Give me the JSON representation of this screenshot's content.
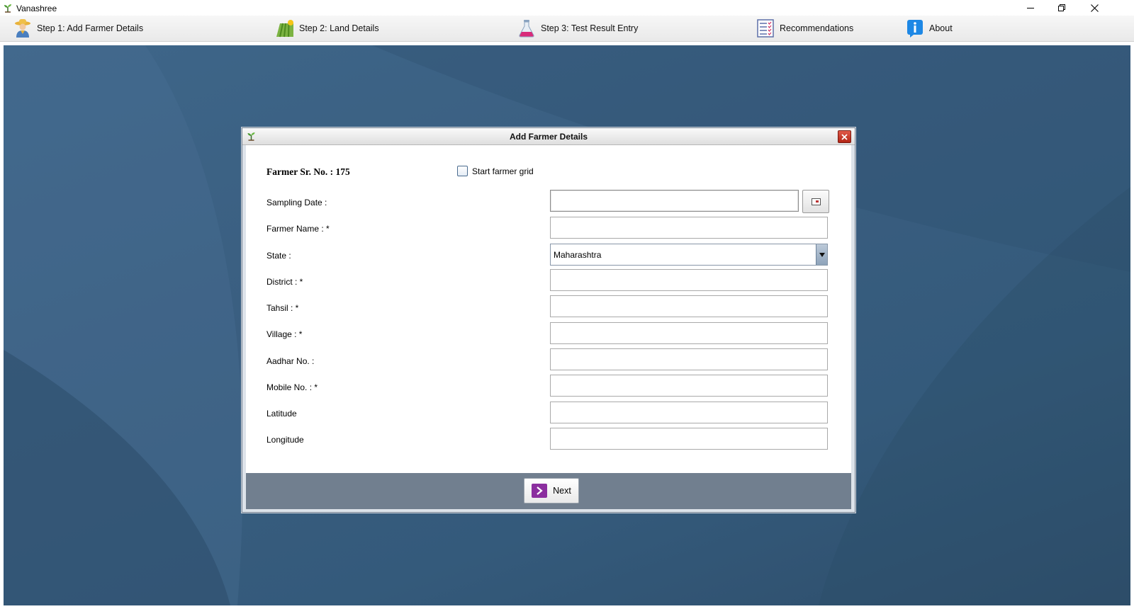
{
  "window": {
    "title": "Vanashree",
    "controls": [
      "minimize-icon",
      "restore-icon",
      "close-icon"
    ]
  },
  "toolbar": {
    "items": [
      {
        "label": "Step 1: Add Farmer Details",
        "icon": "farmer-icon"
      },
      {
        "label": "Step 2: Land Details",
        "icon": "field-icon"
      },
      {
        "label": "Step 3: Test Result Entry",
        "icon": "flask-icon"
      },
      {
        "label": "Recommendations",
        "icon": "checklist-icon"
      },
      {
        "label": "About",
        "icon": "info-icon"
      }
    ]
  },
  "dialog": {
    "title": "Add Farmer Details",
    "farmer_sr_label": "Farmer Sr. No.  : 175",
    "start_grid_label": "Start farmer grid",
    "fields": [
      {
        "label": "Sampling Date :",
        "value": ""
      },
      {
        "label": "Farmer Name : *",
        "value": ""
      },
      {
        "label": "State :",
        "value": "Maharashtra"
      },
      {
        "label": "District : *",
        "value": ""
      },
      {
        "label": "Tahsil : *",
        "value": ""
      },
      {
        "label": "Village : *",
        "value": ""
      },
      {
        "label": "Aadhar No. :",
        "value": ""
      },
      {
        "label": "Mobile No. : *",
        "value": ""
      },
      {
        "label": "Latitude",
        "value": ""
      },
      {
        "label": "Longitude",
        "value": ""
      }
    ],
    "next_label": "Next"
  },
  "colors": {
    "desktop_bg": "#3a5e80",
    "footer_bg": "#717f8f",
    "next_icon_bg": "#8b2e9f",
    "close_button": "#c0392b"
  }
}
